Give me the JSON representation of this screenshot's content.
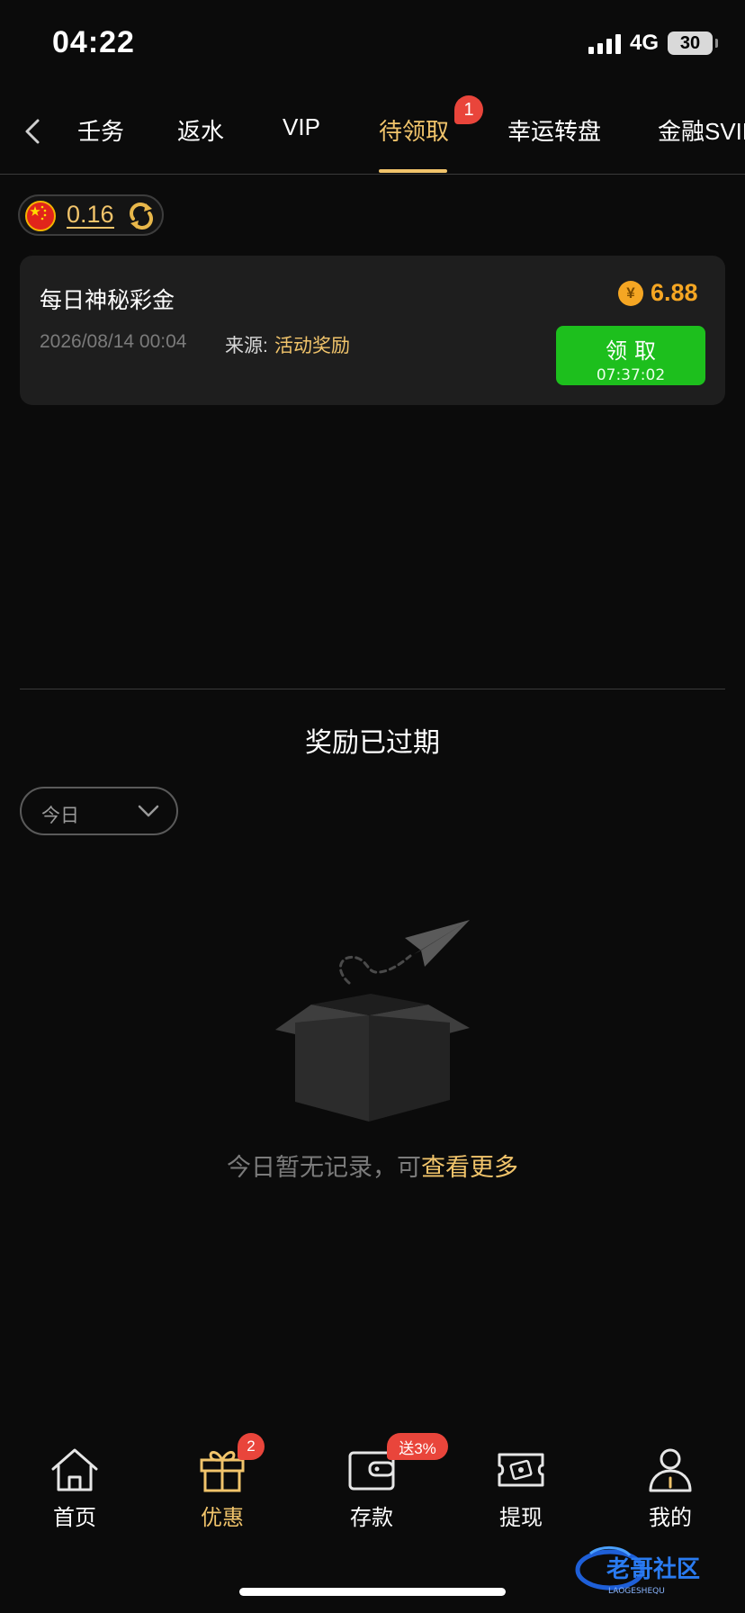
{
  "status_bar": {
    "time": "04:22",
    "network": "4G",
    "battery": "30"
  },
  "tabs": [
    {
      "label": "壬务",
      "active": false
    },
    {
      "label": "返水",
      "active": false
    },
    {
      "label": "VIP",
      "active": false
    },
    {
      "label": "待领取",
      "active": true,
      "badge": "1"
    },
    {
      "label": "幸运转盘",
      "active": false
    },
    {
      "label": "金融SVIP",
      "active": false
    }
  ],
  "balance": {
    "value": "0.16"
  },
  "reward": {
    "title": "每日神秘彩金",
    "currency_symbol": "¥",
    "amount": "6.88",
    "date": "2026/08/14 00:04",
    "source_label": "来源:",
    "source": "活动奖励",
    "claim_label": "领取",
    "claim_timer": "07:37:02"
  },
  "expired": {
    "title": "奖励已过期",
    "filter_value": "今日"
  },
  "empty_state": {
    "text": "今日暂无记录，可",
    "link": "查看更多"
  },
  "bottom_nav": [
    {
      "label": "首页",
      "icon": "home-icon",
      "active": false
    },
    {
      "label": "优惠",
      "icon": "gift-icon",
      "active": true,
      "badge": "2"
    },
    {
      "label": "存款",
      "icon": "wallet-icon",
      "active": false,
      "badge": "送3%"
    },
    {
      "label": "提现",
      "icon": "withdraw-icon",
      "active": false
    },
    {
      "label": "我的",
      "icon": "profile-icon",
      "active": false
    }
  ],
  "watermark": {
    "text": "老哥社区",
    "sub": "LAOGESHEQU"
  },
  "colors": {
    "accent_gold": "#f1c46b",
    "claim_green": "#1dbf1d",
    "badge_red": "#e9453b",
    "background": "#0b0b0b",
    "card": "#1e1e1e"
  }
}
